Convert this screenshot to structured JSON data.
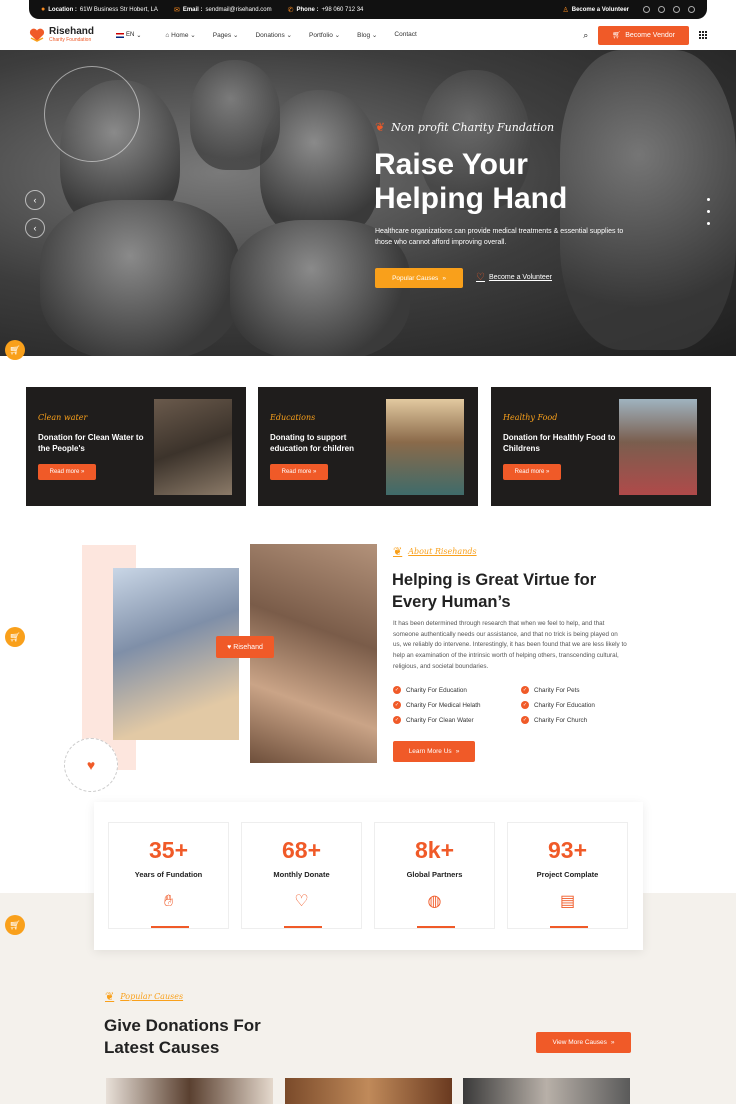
{
  "topbar": {
    "location_label": "Location :",
    "location_value": "61W Business Str Hobert, LA",
    "email_label": "Email :",
    "email_value": "sendmail@risehand.com",
    "phone_label": "Phone :",
    "phone_value": "+98 060 712 34",
    "volunteer": "Become a Volunteer"
  },
  "nav": {
    "logo_name": "Risehand",
    "logo_sub": "Charity Foundation",
    "lang": "EN",
    "menu": [
      "Home",
      "Pages",
      "Donations",
      "Portfolio",
      "Blog",
      "Contact"
    ],
    "vendor_btn": "Become Vendor"
  },
  "hero": {
    "tag": "Non profit Charity Fundation",
    "title": "Raise Your Helping Hand",
    "desc": "Healthcare organizations can provide medical treatments & essential supplies to those who cannot afford improving overall.",
    "btn_causes": "Popular Causes",
    "volunteer_link": "Become a Volunteer"
  },
  "cards": [
    {
      "category": "Clean water",
      "title": "Donation for Clean Water to the People's",
      "btn": "Read more"
    },
    {
      "category": "Educations",
      "title": "Donating to support education for children",
      "btn": "Read more"
    },
    {
      "category": "Healthy Food",
      "title": "Donation for Healthly Food to Childrens",
      "btn": "Read more"
    }
  ],
  "about": {
    "tag": "About Risehands",
    "title": "Helping is Great Virtue for Every Human’s",
    "desc": "It has been determined through research that when we feel to help, and that someone authentically needs our assistance, and that no trick is being played on us, we reliably do intervene. Interestingly, it has been found that we are less likely to help an examination of the intrinsic worth of helping others, transcending cultural, religious, and societal boundaries.",
    "features": [
      "Charity For Education",
      "Charity For Pets",
      "Charity For Medical Helath",
      "Charity For Education",
      "Charity For Clean Water",
      "Charity For Church"
    ],
    "btn": "Learn More Us",
    "badge": "Risehand"
  },
  "stats": [
    {
      "num": "35+",
      "label": "Years of Fundation"
    },
    {
      "num": "68+",
      "label": "Monthly Donate"
    },
    {
      "num": "8k+",
      "label": "Global Partners"
    },
    {
      "num": "93+",
      "label": "Project Complate"
    }
  ],
  "causes": {
    "tag": "Popular Causes",
    "title": "Give Donations For Latest Causes",
    "btn": "View More Causes"
  },
  "colors": {
    "accent": "#f05a28",
    "yellow": "#f9a01b",
    "dark": "#1f1d1c"
  }
}
